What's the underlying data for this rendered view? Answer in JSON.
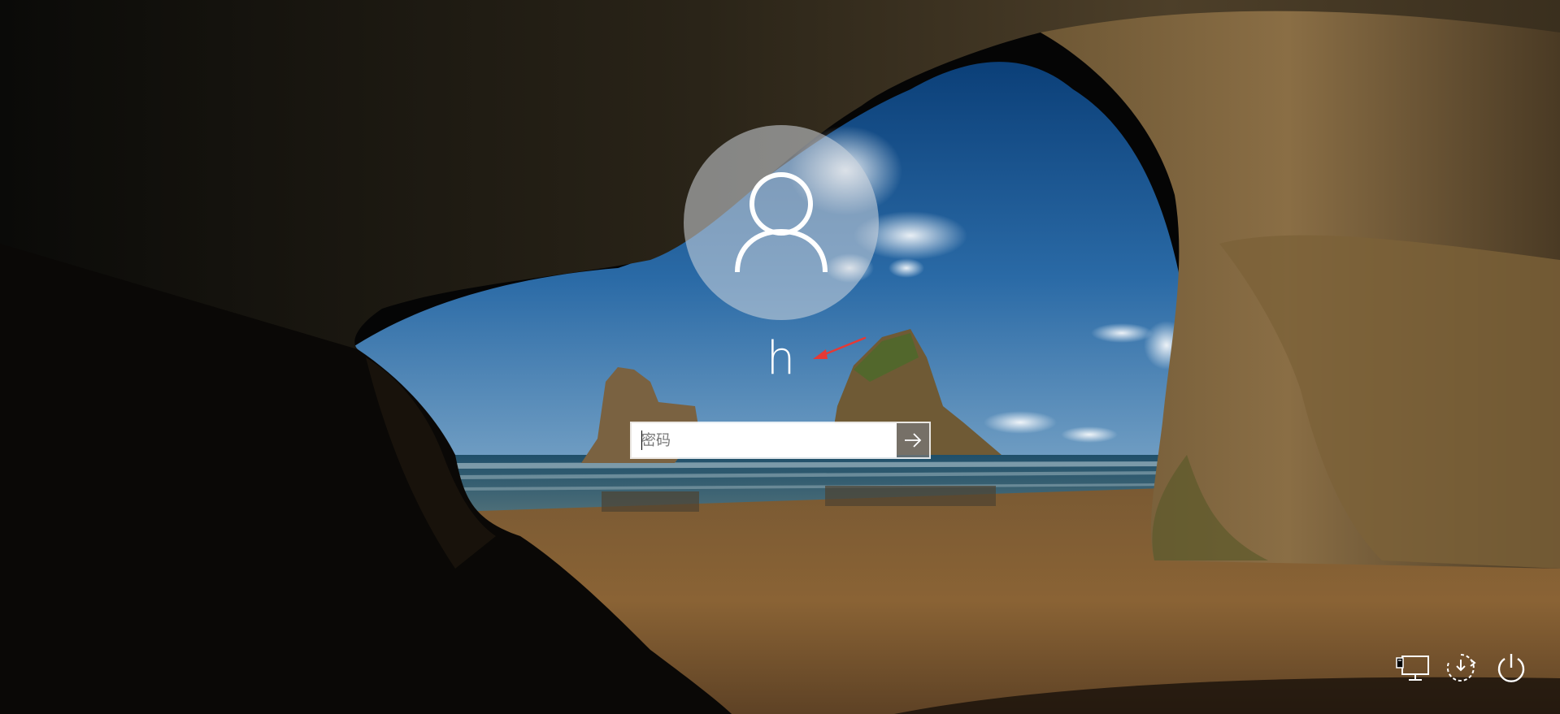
{
  "login": {
    "username": "h",
    "password_placeholder": "密码",
    "password_value": ""
  },
  "icons": {
    "avatar": "user-silhouette-icon",
    "submit": "arrow-right-icon",
    "network": "network-icon",
    "accessibility": "ease-of-access-icon",
    "power": "power-icon"
  },
  "colors": {
    "annotation_arrow": "#e53935",
    "text": "#ffffff"
  }
}
